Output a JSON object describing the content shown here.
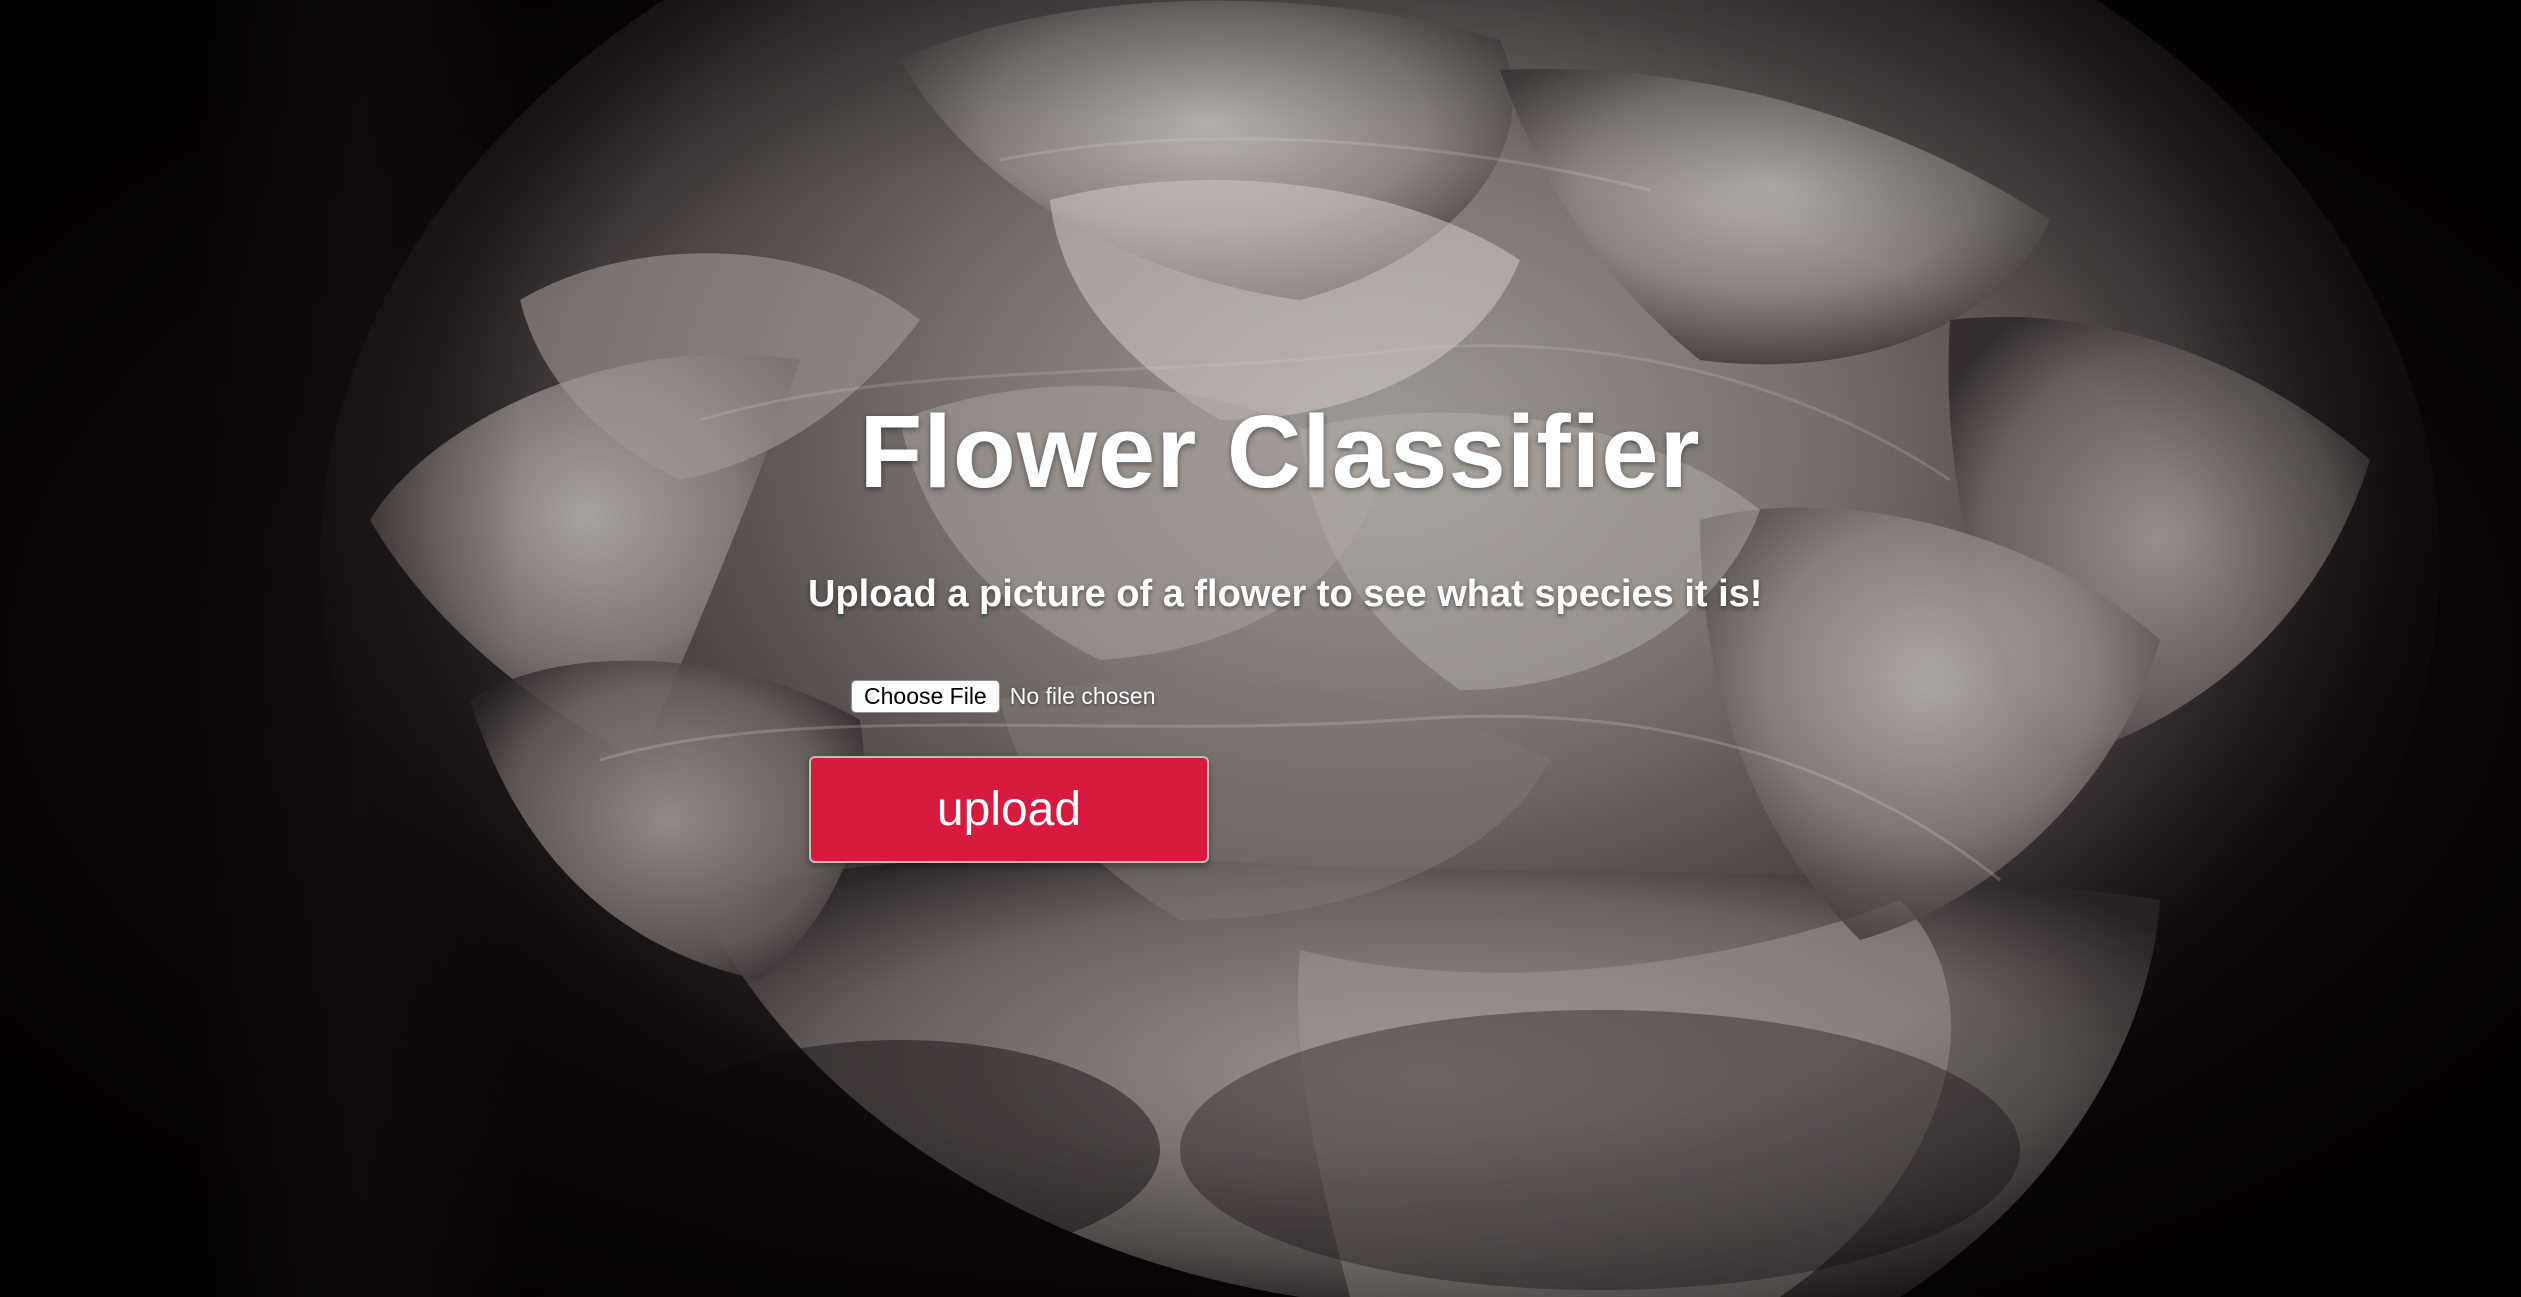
{
  "page": {
    "title": "Flower Classifier",
    "subtitle": "Upload a picture of a flower to see what species it is!"
  },
  "file_input": {
    "button_label": "Choose File",
    "status_text": "No file chosen"
  },
  "upload_button": {
    "label": "upload"
  },
  "colors": {
    "accent": "#d81a3f",
    "background": "#0a0405",
    "text": "#ffffff"
  },
  "background_image": {
    "icon": "flower-photo-grayscale"
  }
}
